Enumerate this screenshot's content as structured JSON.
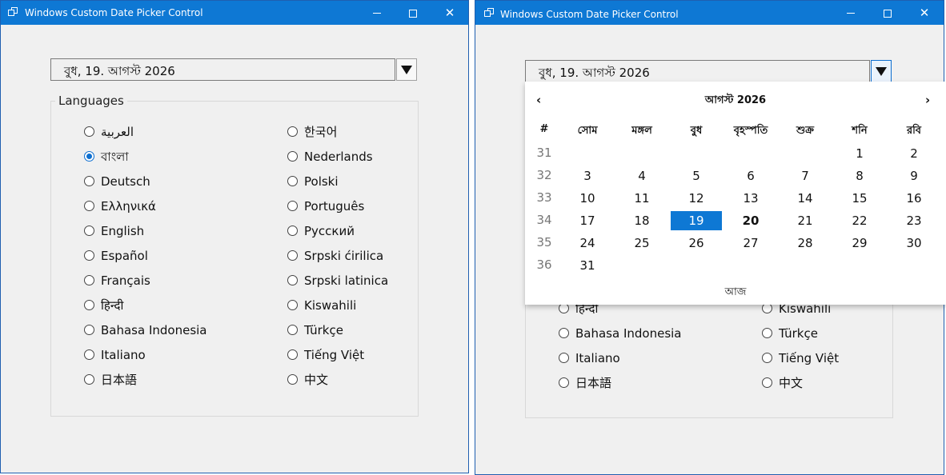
{
  "windows": [
    {
      "title": "Windows Custom Date Picker Control",
      "date_value": "বুধ,  19. আগস্ট 2026",
      "group_label": "Languages"
    },
    {
      "title": "Windows Custom Date Picker Control",
      "date_value": "বুধ,  19. আগস্ট 2026"
    }
  ],
  "languages_left": [
    "العربية",
    "বাংলা",
    "Deutsch",
    "Ελληνικά",
    "English",
    "Español",
    "Français",
    "हिन्दी",
    "Bahasa Indonesia",
    "Italiano",
    "日本語"
  ],
  "languages_right": [
    "한국어",
    "Nederlands",
    "Polski",
    "Português",
    "Русский",
    "Srpski ćirilica",
    "Srpski latinica",
    "Kiswahili",
    "Türkçe",
    "Tiếng Việt",
    "中文"
  ],
  "selected_language": "বাংলা",
  "calendar": {
    "month_title": "আগস্ট 2026",
    "prev": "‹",
    "next": "›",
    "week_header": "#",
    "day_names": [
      "সোম",
      "মঙ্গল",
      "বুধ",
      "বৃহস্পতি",
      "শুক্র",
      "শনি",
      "রবি"
    ],
    "weeks": [
      {
        "num": "31",
        "days": [
          "",
          "",
          "",
          "",
          "",
          "1",
          "2"
        ]
      },
      {
        "num": "32",
        "days": [
          "3",
          "4",
          "5",
          "6",
          "7",
          "8",
          "9"
        ]
      },
      {
        "num": "33",
        "days": [
          "10",
          "11",
          "12",
          "13",
          "14",
          "15",
          "16"
        ]
      },
      {
        "num": "34",
        "days": [
          "17",
          "18",
          "19",
          "20",
          "21",
          "22",
          "23"
        ]
      },
      {
        "num": "35",
        "days": [
          "24",
          "25",
          "26",
          "27",
          "28",
          "29",
          "30"
        ]
      },
      {
        "num": "36",
        "days": [
          "31",
          "",
          "",
          "",
          "",
          "",
          ""
        ]
      }
    ],
    "selected_day": "19",
    "today_day": "20",
    "today_label": "আজ"
  },
  "icons": {
    "close": "close-icon",
    "minimize": "minimize-icon",
    "maximize": "maximize-icon",
    "dropdown": "dropdown-arrow-icon",
    "app": "app-icon"
  },
  "colors": {
    "titlebar": "#0e78d4",
    "selection": "#0e78d4",
    "background": "#f0f0f0"
  }
}
